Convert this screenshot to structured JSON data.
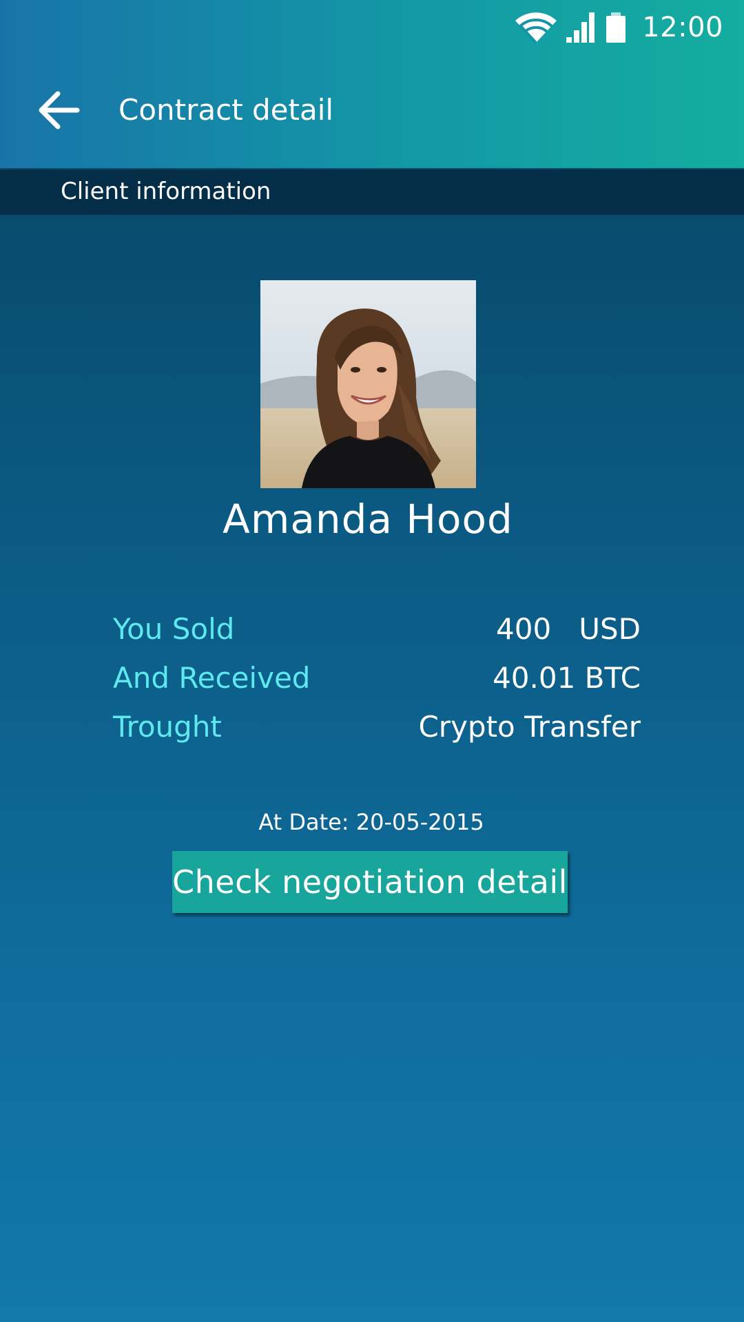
{
  "status_bar": {
    "time": "12:00",
    "icons": [
      "wifi-icon",
      "signal-icon",
      "battery-icon"
    ]
  },
  "toolbar": {
    "back_icon": "arrow-left-icon",
    "title": "Contract detail"
  },
  "section": {
    "title": "Client information"
  },
  "client": {
    "name": "Amanda Hood",
    "photo": "client-photo"
  },
  "details": [
    {
      "label": "You Sold",
      "value": "400   USD"
    },
    {
      "label": "And Received",
      "value": "40.01 BTC"
    },
    {
      "label": "Trought",
      "value": "Crypto Transfer"
    }
  ],
  "date_text": "At Date: 20-05-2015",
  "action": {
    "label": "Check negotiation detail"
  },
  "colors": {
    "header_left": "#1874a8",
    "header_right": "#14ad9f",
    "section_bg": "#042d47",
    "label_color": "#5ee9ef",
    "button_bg": "#17a59c"
  }
}
